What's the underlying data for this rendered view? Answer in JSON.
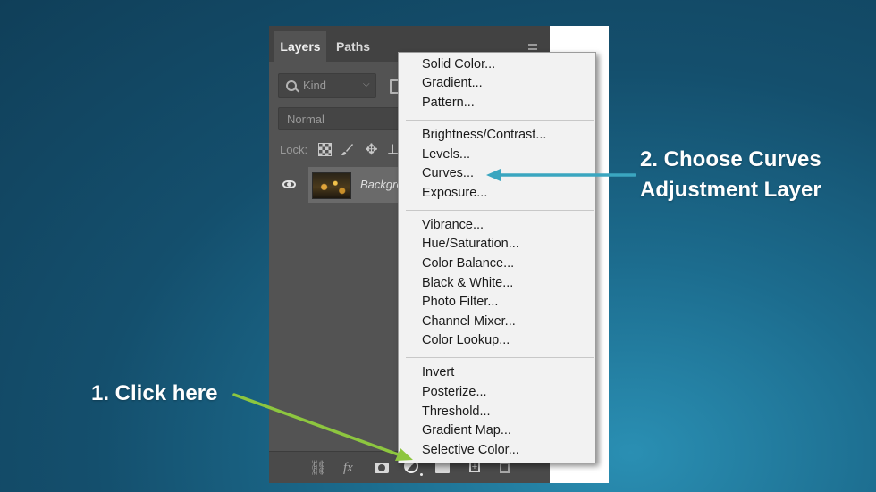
{
  "panel": {
    "tabs": [
      "Layers",
      "Paths"
    ],
    "kind_filter": "Kind",
    "blend_mode": "Normal",
    "lock_label": "Lock:",
    "layer_name": "Backgro"
  },
  "bottom_bar": {
    "fx_label": "fx"
  },
  "adjustment_menu": {
    "items": [
      "Solid Color...",
      "Gradient...",
      "Pattern...",
      "Brightness/Contrast...",
      "Levels...",
      "Curves...",
      "Exposure...",
      "Vibrance...",
      "Hue/Saturation...",
      "Color Balance...",
      "Black & White...",
      "Photo Filter...",
      "Channel Mixer...",
      "Color Lookup...",
      "Invert",
      "Posterize...",
      "Threshold...",
      "Gradient Map...",
      "Selective Color..."
    ]
  },
  "annotations": {
    "step1": "1. Click here",
    "step2_line1": "2. Choose Curves",
    "step2_line2": "Adjustment Layer",
    "step1_arrow_color": "#8dc63f",
    "step2_arrow_color": "#3aa6c0"
  }
}
